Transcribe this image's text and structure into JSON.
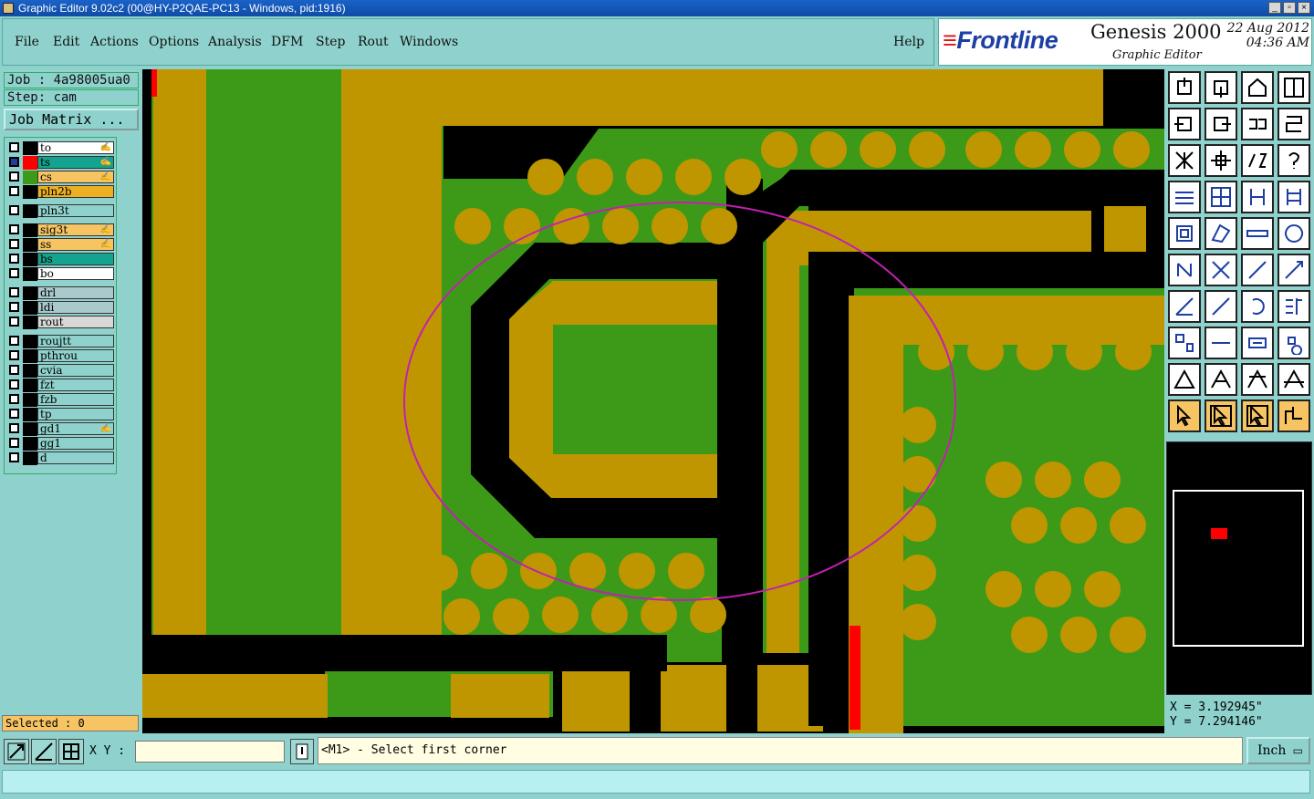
{
  "window": {
    "title": "Graphic Editor 9.02c2 (00@HY-P2QAE-PC13 - Windows, pid:1916)",
    "controls": [
      "minimize",
      "maximize",
      "close"
    ]
  },
  "menu": {
    "items": [
      "File",
      "Edit",
      "Actions",
      "Options",
      "Analysis",
      "DFM",
      "Step",
      "Rout",
      "Windows"
    ],
    "help": "Help"
  },
  "brand": {
    "logo": "Frontline",
    "product": "Genesis 2000",
    "subtitle": "Graphic Editor",
    "date_line1": "22 Aug 2012",
    "date_line2": "04:36 AM"
  },
  "job": {
    "job_label": "Job : 4a98005ua0",
    "step_label": "Step: cam",
    "matrix_button": "Job Matrix ..."
  },
  "layers": [
    {
      "name": "to",
      "color": "#ffffff",
      "swatch": "#000000",
      "checked": false,
      "affected": true
    },
    {
      "name": "ts",
      "color": "#14a38f",
      "swatch": "#ff0000",
      "checked": true,
      "affected": true
    },
    {
      "name": "cs",
      "color": "#f6c463",
      "swatch": "#3d9a18",
      "checked": false,
      "affected": true
    },
    {
      "name": "pln2b",
      "color": "#ecb022",
      "swatch": "#000000",
      "checked": false,
      "affected": false
    },
    {
      "name": "pln3t",
      "color": "#8fd2cd",
      "swatch": "#000000",
      "checked": false,
      "affected": false
    },
    {
      "name": "sig3t",
      "color": "#f6c463",
      "swatch": "#000000",
      "checked": false,
      "affected": true
    },
    {
      "name": "ss",
      "color": "#f6c463",
      "swatch": "#000000",
      "checked": false,
      "affected": true
    },
    {
      "name": "bs",
      "color": "#14a38f",
      "swatch": "#000000",
      "checked": false,
      "affected": false
    },
    {
      "name": "bo",
      "color": "#ffffff",
      "swatch": "#000000",
      "checked": false,
      "affected": false
    },
    {
      "name": "drl",
      "color": "#a9c9cc",
      "swatch": "#000000",
      "checked": false,
      "affected": false
    },
    {
      "name": "ldi",
      "color": "#a9c9cc",
      "swatch": "#000000",
      "checked": false,
      "affected": false
    },
    {
      "name": "rout",
      "color": "#d8d8d8",
      "swatch": "#000000",
      "checked": false,
      "affected": false
    },
    {
      "name": "roujtt",
      "color": "#8fd2cd",
      "swatch": "#000000",
      "checked": false,
      "affected": false
    },
    {
      "name": "pthrou",
      "color": "#8fd2cd",
      "swatch": "#000000",
      "checked": false,
      "affected": false
    },
    {
      "name": "cvia",
      "color": "#8fd2cd",
      "swatch": "#000000",
      "checked": false,
      "affected": false
    },
    {
      "name": "fzt",
      "color": "#8fd2cd",
      "swatch": "#000000",
      "checked": false,
      "affected": false
    },
    {
      "name": "fzb",
      "color": "#8fd2cd",
      "swatch": "#000000",
      "checked": false,
      "affected": false
    },
    {
      "name": "tp",
      "color": "#8fd2cd",
      "swatch": "#000000",
      "checked": false,
      "affected": false
    },
    {
      "name": "gd1",
      "color": "#8fd2cd",
      "swatch": "#000000",
      "checked": false,
      "affected": true
    },
    {
      "name": "gg1",
      "color": "#8fd2cd",
      "swatch": "#000000",
      "checked": false,
      "affected": false
    },
    {
      "name": "d",
      "color": "#8fd2cd",
      "swatch": "#000000",
      "checked": false,
      "affected": false
    }
  ],
  "selected": "Selected : 0",
  "coords": {
    "x": "X = 3.192945\"",
    "y": "Y = 7.294146\""
  },
  "bottom": {
    "xy_label": "X Y :",
    "xy_value": "",
    "prompt": "<M1> - Select first corner",
    "unit": "Inch"
  },
  "colors": {
    "board_green": "#3d9a18",
    "copper_gold": "#bf9600",
    "highlight_red": "#ff0000",
    "ellipse_magenta": "#c21fb2",
    "panel_teal": "#8fd2cd"
  },
  "tool_icons": [
    "zoom-in-top-icon",
    "zoom-bottom-icon",
    "home-icon",
    "split-view-icon",
    "pan-left-icon",
    "pan-right-icon",
    "mirror-icon",
    "rotate-icon",
    "fit-all-icon",
    "center-icon",
    "scale-1-2-icon",
    "help-query-icon",
    "measure-tools-icon",
    "grid-icon",
    "snap-red-icon",
    "snap-red-2-icon",
    "pad-icon",
    "resize-icon",
    "ruler-icon",
    "circle-pad-icon",
    "connect-nodes-icon",
    "cross-node-icon",
    "line-node-icon",
    "line-node-2-icon",
    "angle-line-icon",
    "diagonal-line-icon",
    "arc-icon",
    "trace-bus-icon",
    "pad-snap-icon",
    "horizontal-line-icon",
    "distance-icon",
    "nodes-icon",
    "triangle-icon",
    "triangle-a-icon",
    "triangle-b-icon",
    "triangle-c-icon",
    "pointer-icon",
    "select-pointer-icon",
    "select-pointer-2-icon",
    "route-select-icon"
  ]
}
